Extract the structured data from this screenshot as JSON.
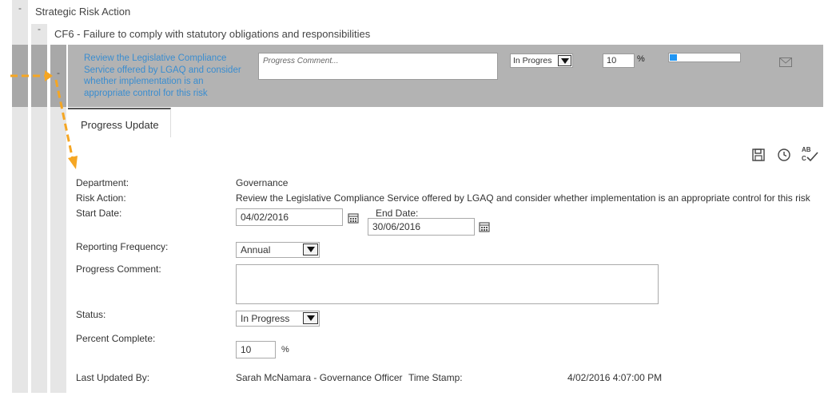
{
  "tree": {
    "level1": {
      "toggle": "-",
      "label": "Strategic Risk Action"
    },
    "level2": {
      "toggle": "-",
      "label": "CF6 - Failure to comply with statutory obligations and responsibilities"
    },
    "level3": {
      "toggle": "-"
    }
  },
  "action_row": {
    "title": "Review the Legislative Compliance Service offered by LGAQ and consider whether implementation is an appropriate control for this risk",
    "comment_placeholder": "Progress Comment...",
    "status_value": "In Progres",
    "percent_value": "10",
    "percent_symbol": "%",
    "progress": 0.1,
    "mail_icon": "envelope-icon"
  },
  "tabs": [
    {
      "label": "Progress Update"
    }
  ],
  "toolbar": {
    "icons": [
      "save-icon",
      "history-clock-icon",
      "spellcheck-icon"
    ],
    "spellcheck_text": "AB"
  },
  "form": {
    "department_label": "Department:",
    "department_value": "Governance",
    "risk_action_label": "Risk Action:",
    "risk_action_value": "Review the Legislative Compliance Service offered by LGAQ and consider whether implementation is an appropriate control for this risk",
    "start_date_label": "Start Date:",
    "start_date_value": "04/02/2016",
    "end_date_label": "End Date:",
    "end_date_value": "30/06/2016",
    "reporting_frequency_label": "Reporting Frequency:",
    "reporting_frequency_value": "Annual",
    "progress_comment_label": "Progress Comment:",
    "progress_comment_value": "",
    "status_label": "Status:",
    "status_value": "In Progress",
    "percent_label": "Percent Complete:",
    "percent_value": "10",
    "percent_symbol": "%",
    "last_updated_label": "Last Updated By:",
    "last_updated_value": "Sarah McNamara - Governance Officer",
    "timestamp_label": "Time Stamp:",
    "timestamp_value": "4/02/2016 4:07:00 PM"
  },
  "colors": {
    "link": "#3a8dd0",
    "band": "#b3b3b3",
    "gutter": "#e6e6e6",
    "annotation_arrow": "#f5a623",
    "progress": "#2196f3"
  }
}
